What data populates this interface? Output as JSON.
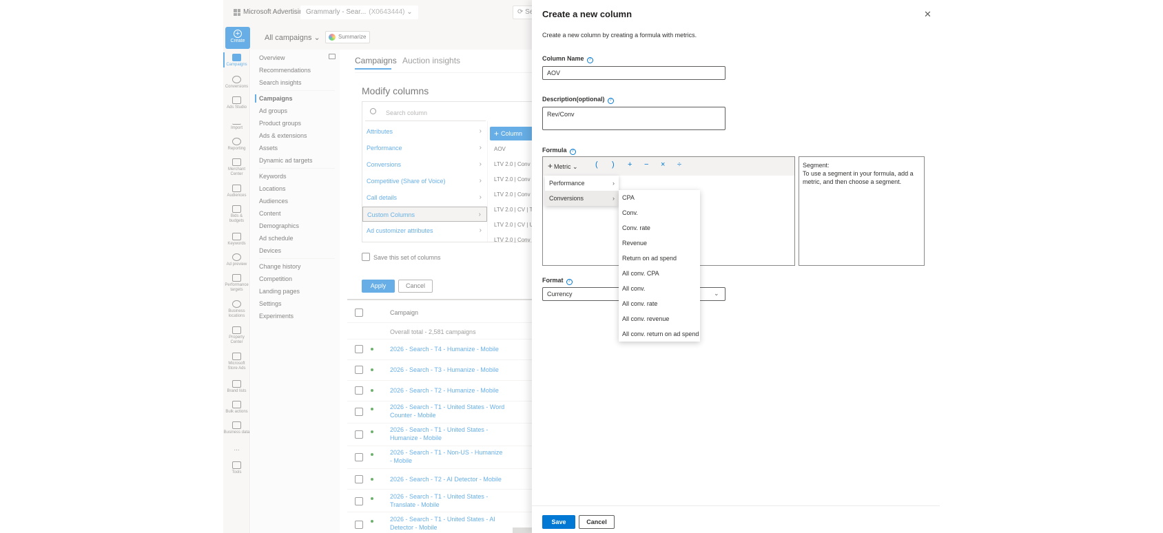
{
  "topbar": {
    "brand": "Microsoft Advertising",
    "account_name": "Grammarly - Sear...",
    "account_id": "(X0643444)",
    "search_partial": "Se"
  },
  "header": {
    "create_label": "Create",
    "campaign_selector": "All campaigns",
    "summarize_label": "Summarize"
  },
  "rail": [
    {
      "label": "Campaigns",
      "active": true
    },
    {
      "label": "Conversions"
    },
    {
      "label": "Ads Studio"
    },
    {
      "label": "Import"
    },
    {
      "label": "Reporting"
    },
    {
      "label": "Merchant Center"
    },
    {
      "label": "Audiences"
    },
    {
      "label": "Bids & budgets"
    },
    {
      "label": "Keywords"
    },
    {
      "label": "Ad preview"
    },
    {
      "label": "Performance targets"
    },
    {
      "label": "Business locations"
    },
    {
      "label": "Property Center"
    },
    {
      "label": "Microsoft Store Ads"
    },
    {
      "label": "Brand lists"
    },
    {
      "label": "Bulk actions"
    },
    {
      "label": "Business data"
    },
    {
      "label": "..."
    },
    {
      "label": "Tools"
    }
  ],
  "nav": {
    "group1": [
      "Overview",
      "Recommendations",
      "Search insights"
    ],
    "group2": [
      "Campaigns",
      "Ad groups",
      "Product groups",
      "Ads & extensions",
      "Assets",
      "Dynamic ad targets"
    ],
    "group3": [
      "Keywords",
      "Locations",
      "Audiences",
      "Content",
      "Demographics",
      "Ad schedule",
      "Devices"
    ],
    "group4": [
      "Change history",
      "Competition",
      "Landing pages",
      "Settings",
      "Experiments"
    ]
  },
  "main": {
    "tabs": [
      "Campaigns",
      "Auction insights"
    ],
    "modify_title": "Modify columns",
    "search_placeholder": "Search column",
    "categories": [
      "Attributes",
      "Performance",
      "Conversions",
      "Competitive (Share of Voice)",
      "Call details",
      "Custom Columns",
      "Ad customizer attributes"
    ],
    "add_column_label": "Column",
    "custom_columns": [
      "AOV",
      "LTV 2.0 | Conv",
      "LTV 2.0 | Conv",
      "LTV 2.0 | Conv",
      "LTV 2.0 | CV | T",
      "LTV 2.0 | CV | U",
      "LTV 2.0 | Conv"
    ],
    "save_set_label": "Save this set of columns",
    "apply_label": "Apply",
    "cancel_label": "Cancel",
    "grid_header": "Campaign",
    "overall_total": "Overall total - 2,581 campaigns",
    "rows": [
      "2026 - Search - T4 - Humanize - Mobile",
      "2026 - Search - T3 - Humanize - Mobile",
      "2026 - Search - T2 - Humanize - Mobile",
      "2026 - Search - T1 - United States - Word Counter - Mobile",
      "2026 - Search - T1 - United States - Humanize - Mobile",
      "2026 - Search - T1 - Non-US - Humanize - Mobile",
      "2026 - Search - T2 - AI Detector - Mobile",
      "2026 - Search - T1 - United States - Translate - Mobile",
      "2026 - Search - T1 - United States - AI Detector - Mobile"
    ]
  },
  "panel": {
    "title": "Create a new column",
    "description": "Create a new column by creating a formula with metrics.",
    "column_name_label": "Column Name",
    "column_name_value": "AOV",
    "description_label": "Description(optional)",
    "description_value": "Rev/Conv",
    "formula_label": "Formula",
    "metric_label": "Metric",
    "operators": [
      "(",
      ")",
      "+",
      "−",
      "×",
      "÷"
    ],
    "segment_title": "Segment:",
    "segment_text": "To use a segment in your formula, add a metric, and then choose a segment.",
    "format_label": "Format",
    "format_value": "Currency",
    "menu_groups": [
      "Performance",
      "Conversions"
    ],
    "conversion_metrics": [
      "CPA",
      "Conv.",
      "Conv. rate",
      "Revenue",
      "Return on ad spend",
      "All conv. CPA",
      "All conv.",
      "All conv. rate",
      "All conv. revenue",
      "All conv. return on ad spend"
    ],
    "save_label": "Save",
    "cancel_label": "Cancel"
  },
  "colors": {
    "accent": "#0078d4",
    "status_active": "#107c10"
  }
}
